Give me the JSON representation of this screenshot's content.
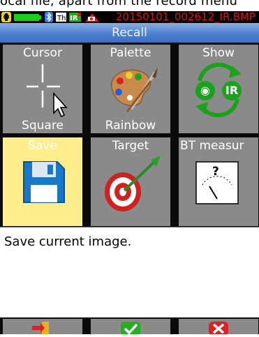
{
  "caption_fragment": "ocal file, apart from the record menu",
  "status": {
    "filename": "20150101_002612_IR.BMP",
    "battery_color": "#18d018",
    "bluetooth_color": "#2e7bff"
  },
  "header": {
    "title": "Recall"
  },
  "tiles": [
    {
      "top": "Cursor",
      "bottom": "Square",
      "icon": "crosshair-cursor-icon"
    },
    {
      "top": "Palette",
      "bottom": "Rainbow",
      "icon": "palette-icon"
    },
    {
      "top": "Show",
      "bottom": "",
      "icon": "swap-visible-ir-icon"
    },
    {
      "top": "Save",
      "bottom": "",
      "icon": "floppy-disk-icon",
      "selected": true
    },
    {
      "top": "Target",
      "bottom": "",
      "icon": "target-dart-icon"
    },
    {
      "top": "BT measur",
      "bottom": "",
      "icon": "gauge-icon"
    }
  ],
  "show_icon": {
    "eye_label": "◉",
    "ir_label": "IR"
  },
  "gauge_symbol": "?",
  "description": "Save current image.",
  "footer": {
    "buttons": [
      "exit-icon",
      "confirm-icon",
      "cancel-icon"
    ]
  }
}
